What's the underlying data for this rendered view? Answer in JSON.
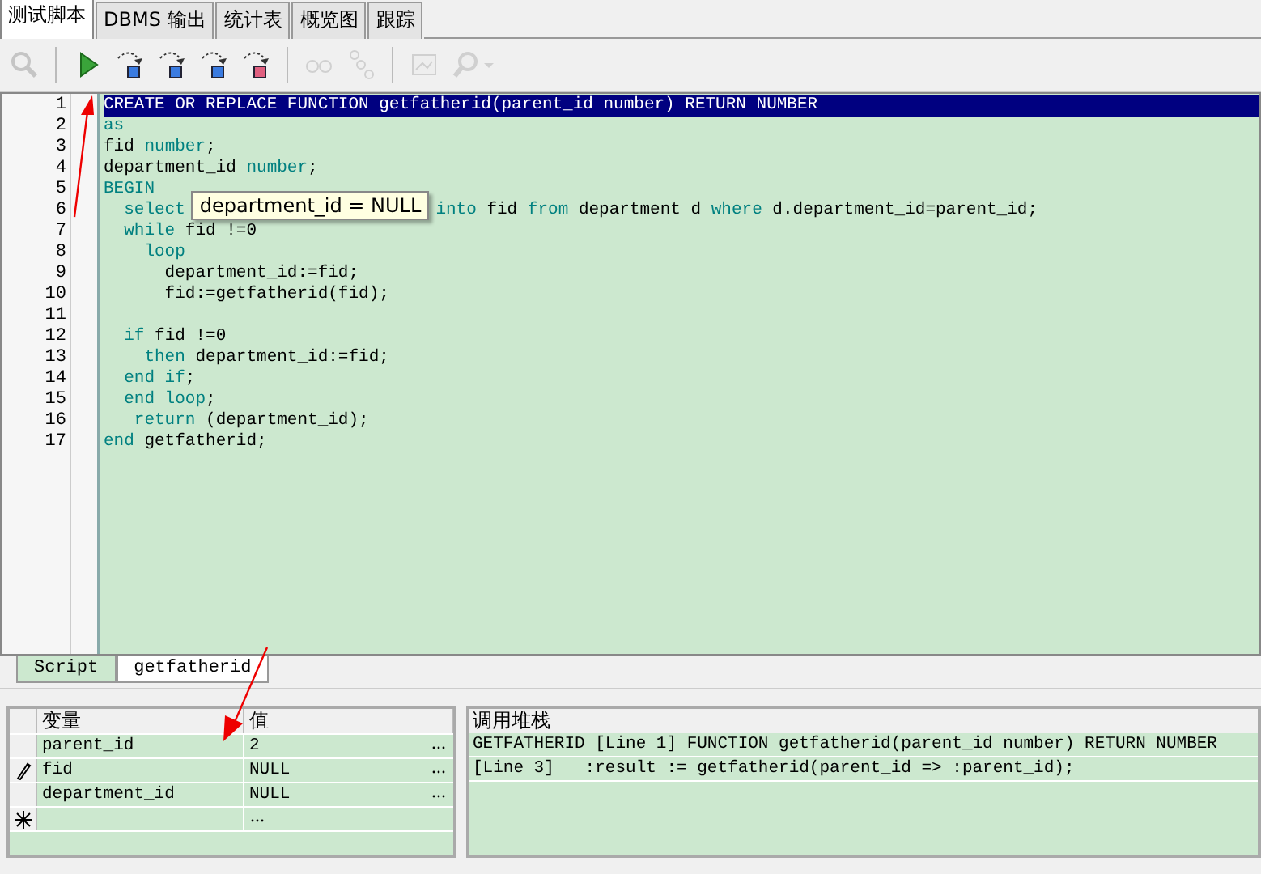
{
  "tabs": [
    {
      "label": "测试脚本",
      "selected": true
    },
    {
      "label": "DBMS 输出",
      "selected": false
    },
    {
      "label": "统计表",
      "selected": false
    },
    {
      "label": "概览图",
      "selected": false
    },
    {
      "label": "跟踪",
      "selected": false
    }
  ],
  "toolbar": [
    {
      "kind": "inspect",
      "disabled": true
    },
    {
      "kind": "sep"
    },
    {
      "kind": "run",
      "disabled": false
    },
    {
      "kind": "step-into",
      "disabled": false
    },
    {
      "kind": "step-over",
      "disabled": false
    },
    {
      "kind": "step-out",
      "disabled": false
    },
    {
      "kind": "run-exception",
      "disabled": false
    },
    {
      "kind": "sep"
    },
    {
      "kind": "watch",
      "disabled": true
    },
    {
      "kind": "bits",
      "disabled": true
    },
    {
      "kind": "sep"
    },
    {
      "kind": "image",
      "disabled": true
    },
    {
      "kind": "find",
      "disabled": true
    }
  ],
  "editor": {
    "lines": [
      {
        "number": "1",
        "selected": true,
        "tokens": [
          {
            "text": "CREATE OR REPLACE FUNCTION getfatherid(parent_id number) RETURN NUMBER",
            "kind": "plain"
          }
        ]
      },
      {
        "number": "2",
        "selected": false,
        "tokens": [
          {
            "text": "as",
            "kind": "keyword"
          }
        ]
      },
      {
        "number": "3",
        "selected": false,
        "tokens": [
          {
            "text": "fid ",
            "kind": "plain"
          },
          {
            "text": "number",
            "kind": "keyword"
          },
          {
            "text": ";",
            "kind": "plain"
          }
        ]
      },
      {
        "number": "4",
        "selected": false,
        "tokens": [
          {
            "text": "department_id ",
            "kind": "plain"
          },
          {
            "text": "number",
            "kind": "keyword"
          },
          {
            "text": ";",
            "kind": "plain"
          }
        ]
      },
      {
        "number": "5",
        "selected": false,
        "tokens": [
          {
            "text": "BEGIN",
            "kind": "keyword"
          }
        ]
      },
      {
        "number": "6",
        "selected": false,
        "tokens": [
          {
            "text": "  select",
            "kind": "keyword"
          },
          {
            "text": "department_id = NULL",
            "kind": "tooltip"
          },
          {
            "text": "into",
            "kind": "keyword"
          },
          {
            "text": " fid ",
            "kind": "plain"
          },
          {
            "text": "from",
            "kind": "keyword"
          },
          {
            "text": " department d ",
            "kind": "plain"
          },
          {
            "text": "where",
            "kind": "keyword"
          },
          {
            "text": " d.department_id=parent_id;",
            "kind": "plain"
          }
        ]
      },
      {
        "number": "7",
        "selected": false,
        "tokens": [
          {
            "text": "  while",
            "kind": "keyword"
          },
          {
            "text": " fid !=0",
            "kind": "plain"
          }
        ]
      },
      {
        "number": "8",
        "selected": false,
        "tokens": [
          {
            "text": "    loop",
            "kind": "keyword"
          }
        ]
      },
      {
        "number": "9",
        "selected": false,
        "tokens": [
          {
            "text": "      department_id:=fid;",
            "kind": "plain"
          }
        ]
      },
      {
        "number": "10",
        "selected": false,
        "tokens": [
          {
            "text": "      fid:=getfatherid(fid);",
            "kind": "plain"
          }
        ]
      },
      {
        "number": "11",
        "selected": false
      },
      {
        "number": "12",
        "selected": false,
        "tokens": [
          {
            "text": "  if",
            "kind": "keyword"
          },
          {
            "text": " fid !=0",
            "kind": "plain"
          }
        ]
      },
      {
        "number": "13",
        "selected": false,
        "tokens": [
          {
            "text": "    then",
            "kind": "keyword"
          },
          {
            "text": " department_id:=fid;",
            "kind": "plain"
          }
        ]
      },
      {
        "number": "14",
        "selected": false,
        "tokens": [
          {
            "text": "  end if",
            "kind": "keyword"
          },
          {
            "text": ";",
            "kind": "plain"
          }
        ]
      },
      {
        "number": "15",
        "selected": false,
        "tokens": [
          {
            "text": "  end loop",
            "kind": "keyword"
          },
          {
            "text": ";",
            "kind": "plain"
          }
        ]
      },
      {
        "number": "16",
        "selected": false,
        "tokens": [
          {
            "text": "   return",
            "kind": "keyword"
          },
          {
            "text": " (department_id);",
            "kind": "plain"
          }
        ]
      },
      {
        "number": "17",
        "selected": false,
        "tokens": [
          {
            "text": "end",
            "kind": "keyword"
          },
          {
            "text": " getfatherid;",
            "kind": "plain"
          }
        ]
      }
    ]
  },
  "bottom_tabs": [
    {
      "label": "Script",
      "selected": false
    },
    {
      "label": "getfatherid",
      "selected": true
    }
  ],
  "variables": {
    "columns": [
      "变量",
      "值"
    ],
    "rows": [
      {
        "kind": "value",
        "name": "parent_id",
        "value": "2",
        "editing": false
      },
      {
        "kind": "value",
        "name": "fid",
        "value": "NULL",
        "editing": true
      },
      {
        "kind": "value",
        "name": "department_id",
        "value": "NULL",
        "editing": false
      },
      {
        "kind": "new"
      }
    ]
  },
  "call_stack": {
    "title": "调用堆栈",
    "lines": [
      "GETFATHERID [Line 1] FUNCTION getfatherid(parent_id number) RETURN NUMBER",
      "[Line 3]   :result := getfatherid(parent_id => :parent_id);"
    ]
  }
}
